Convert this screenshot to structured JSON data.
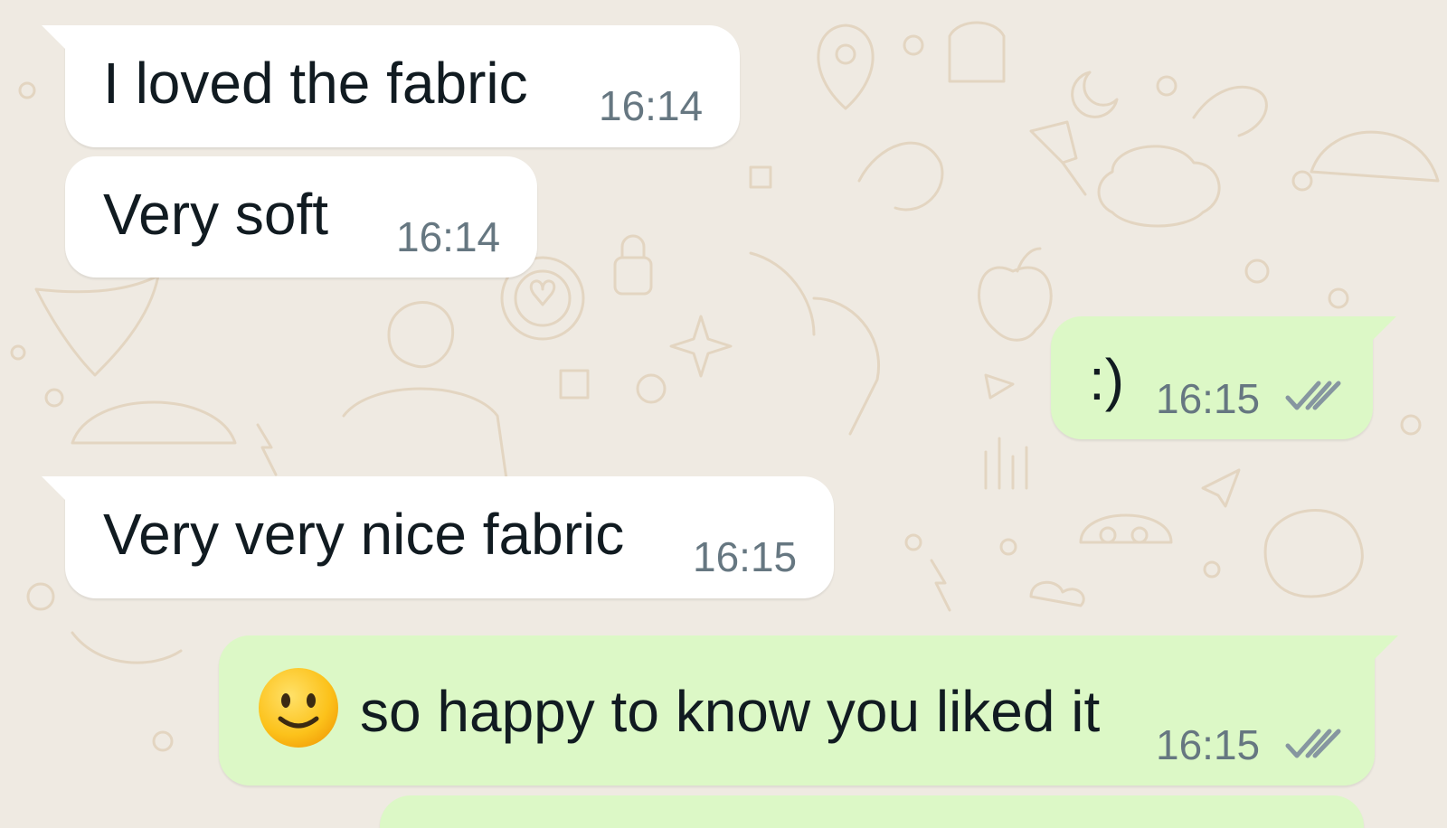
{
  "messages": [
    {
      "direction": "incoming",
      "text": "I loved the fabric",
      "time": "16:14"
    },
    {
      "direction": "incoming",
      "text": "Very soft",
      "time": "16:14"
    },
    {
      "direction": "outgoing",
      "text": ":)",
      "time": "16:15",
      "status": "delivered-double-check"
    },
    {
      "direction": "incoming",
      "text": "Very very nice fabric",
      "time": "16:15"
    },
    {
      "direction": "outgoing",
      "emoji": "slightly-smiling-face",
      "text": "so happy to know you liked it",
      "time": "16:15",
      "status": "delivered-double-check"
    }
  ],
  "colors": {
    "background": "#efeae2",
    "incoming_bubble": "#ffffff",
    "outgoing_bubble": "#dcf8c6",
    "text": "#111b21",
    "meta": "#667781",
    "wallpaper_doodle": "#e2d6c4"
  }
}
